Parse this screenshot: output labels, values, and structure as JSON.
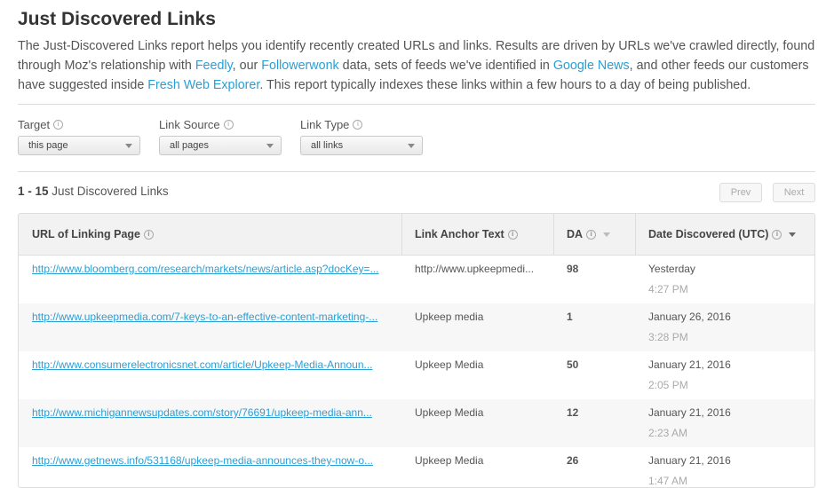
{
  "header": {
    "title": "Just Discovered Links",
    "desc_1": "The Just-Discovered Links report helps you identify recently created URLs and links. Results are driven by URLs we've crawled directly, found through Moz's relationship with ",
    "link_feedly": "Feedly",
    "desc_2": ", our ",
    "link_followerwonk": "Followerwonk",
    "desc_3": " data, sets of feeds we've identified in ",
    "link_google_news": "Google News",
    "desc_4": ", and other feeds our customers have suggested inside ",
    "link_fresh_web_explorer": "Fresh Web Explorer",
    "desc_5": ". This report typically indexes these links within a few hours to a day of being published."
  },
  "filters": {
    "target": {
      "label": "Target",
      "value": "this page"
    },
    "link_source": {
      "label": "Link Source",
      "value": "all pages"
    },
    "link_type": {
      "label": "Link Type",
      "value": "all links"
    }
  },
  "results": {
    "range": "1 - 15",
    "label": " Just Discovered Links",
    "prev_label": "Prev",
    "next_label": "Next"
  },
  "table": {
    "headers": {
      "url": "URL of Linking Page",
      "anchor": "Link Anchor Text",
      "da": "DA",
      "date": "Date Discovered (UTC)"
    },
    "rows": [
      {
        "url": "http://www.bloomberg.com/research/markets/news/article.asp?docKey=...",
        "anchor": "http://www.upkeepmedi...",
        "da": "98",
        "date": "Yesterday",
        "time": "4:27 PM"
      },
      {
        "url": "http://www.upkeepmedia.com/7-keys-to-an-effective-content-marketing-...",
        "anchor": "Upkeep media",
        "da": "1",
        "date": "January 26, 2016",
        "time": "3:28 PM"
      },
      {
        "url": "http://www.consumerelectronicsnet.com/article/Upkeep-Media-Announ...",
        "anchor": "Upkeep Media",
        "da": "50",
        "date": "January 21, 2016",
        "time": "2:05 PM"
      },
      {
        "url": "http://www.michigannewsupdates.com/story/76691/upkeep-media-ann...",
        "anchor": "Upkeep Media",
        "da": "12",
        "date": "January 21, 2016",
        "time": "2:23 AM"
      },
      {
        "url": "http://www.getnews.info/531168/upkeep-media-announces-they-now-o...",
        "anchor": "Upkeep Media",
        "da": "26",
        "date": "January 21, 2016",
        "time": "1:47 AM"
      }
    ]
  },
  "colors": {
    "link": "#2a9fd6",
    "header_bg": "#f2f2f2",
    "alt_row_bg": "#f7f7f7",
    "border": "#dddddd"
  }
}
